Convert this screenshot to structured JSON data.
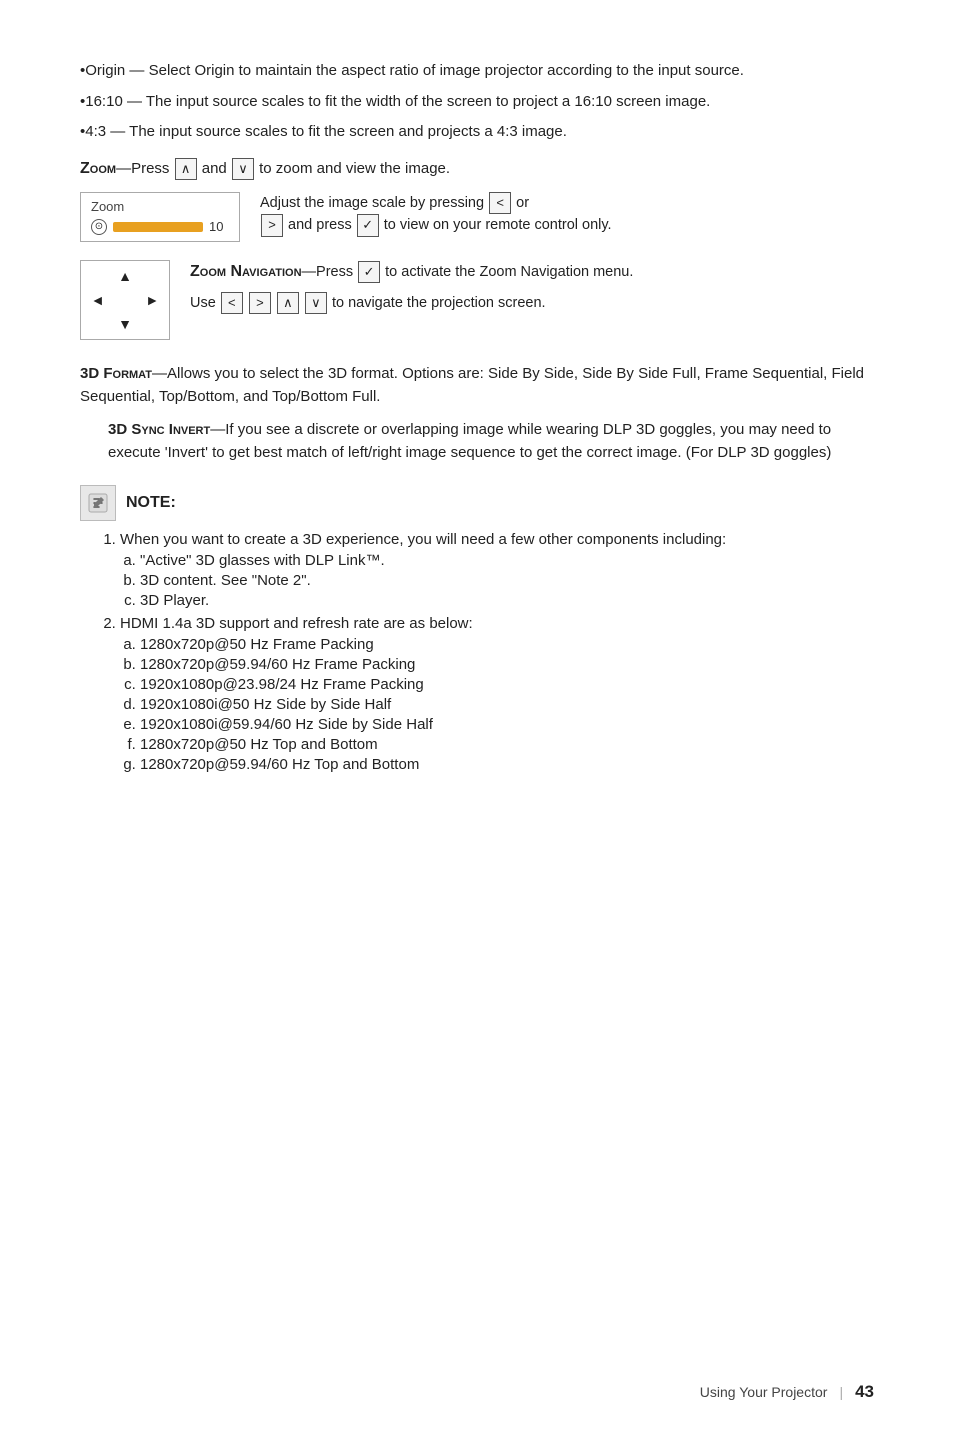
{
  "page": {
    "footer": {
      "text": "Using Your Projector",
      "separator": "|",
      "page_number": "43"
    }
  },
  "content": {
    "bullets": [
      {
        "id": "origin",
        "text": "•Origin — Select Origin to maintain the aspect ratio of image projector according to the input source."
      },
      {
        "id": "ratio_16_10",
        "text": "•16:10 — The input source scales to fit the width of the screen to project a 16:10 screen image."
      },
      {
        "id": "ratio_4_3",
        "text": "•4:3 — The input source scales to fit the screen and projects a 4:3 image."
      }
    ],
    "zoom_heading": "Zoom",
    "zoom_intro": "—Press",
    "zoom_up_symbol": "∧",
    "zoom_and": "and",
    "zoom_down_symbol": "∨",
    "zoom_tail": "to zoom and view the image.",
    "zoom_box": {
      "title": "Zoom",
      "number": "10"
    },
    "zoom_desc": {
      "part1": "Adjust the image scale by pressing",
      "left_symbol": "<",
      "or": "or",
      "right_symbol": ">",
      "part2": "and press",
      "check_symbol": "✓",
      "part3": "to view on your remote control only."
    },
    "zoom_nav_heading": "Zoom Navigation",
    "zoom_nav_intro": "—Press",
    "zoom_nav_symbol": "✓",
    "zoom_nav_tail": "to activate the Zoom Navigation menu.",
    "zoom_nav_use": "Use",
    "zoom_nav_arrows": [
      "<",
      ">",
      "∧",
      "∨"
    ],
    "zoom_nav_tail2": "to navigate the projection screen.",
    "format_3d": {
      "heading": "3D Format",
      "dash": "—",
      "text": "Allows you to select the 3D format. Options are: Side By Side, Side By Side Full, Frame Sequential, Field Sequential, Top/Bottom, and Top/Bottom Full."
    },
    "sync_invert": {
      "heading": "3D Sync Invert",
      "dash": "—",
      "text": "If you see a discrete or overlapping image while wearing DLP 3D goggles, you may need to execute 'Invert' to get best match of left/right image sequence to get the correct image. (For DLP 3D goggles)"
    },
    "note": {
      "title": "NOTE:",
      "items": [
        {
          "number": "1",
          "text": "When you want to create a 3D experience, you will need a few other components including:",
          "sub_items": [
            {
              "letter": "a",
              "text": "\"Active\" 3D glasses with DLP Link™."
            },
            {
              "letter": "b",
              "text": "3D content. See \"Note 2\"."
            },
            {
              "letter": "c",
              "text": "3D Player."
            }
          ]
        },
        {
          "number": "2",
          "text": "HDMI 1.4a 3D support and refresh rate are as below:",
          "sub_items": [
            {
              "letter": "a",
              "text": "1280x720p@50 Hz Frame Packing"
            },
            {
              "letter": "b",
              "text": "1280x720p@59.94/60 Hz Frame Packing"
            },
            {
              "letter": "c",
              "text": "1920x1080p@23.98/24 Hz Frame Packing"
            },
            {
              "letter": "d",
              "text": "1920x1080i@50 Hz Side by Side Half"
            },
            {
              "letter": "e",
              "text": "1920x1080i@59.94/60 Hz Side by Side Half"
            },
            {
              "letter": "f",
              "text": "1280x720p@50 Hz Top and Bottom"
            },
            {
              "letter": "g",
              "text": "1280x720p@59.94/60 Hz Top and Bottom"
            }
          ]
        }
      ]
    }
  }
}
